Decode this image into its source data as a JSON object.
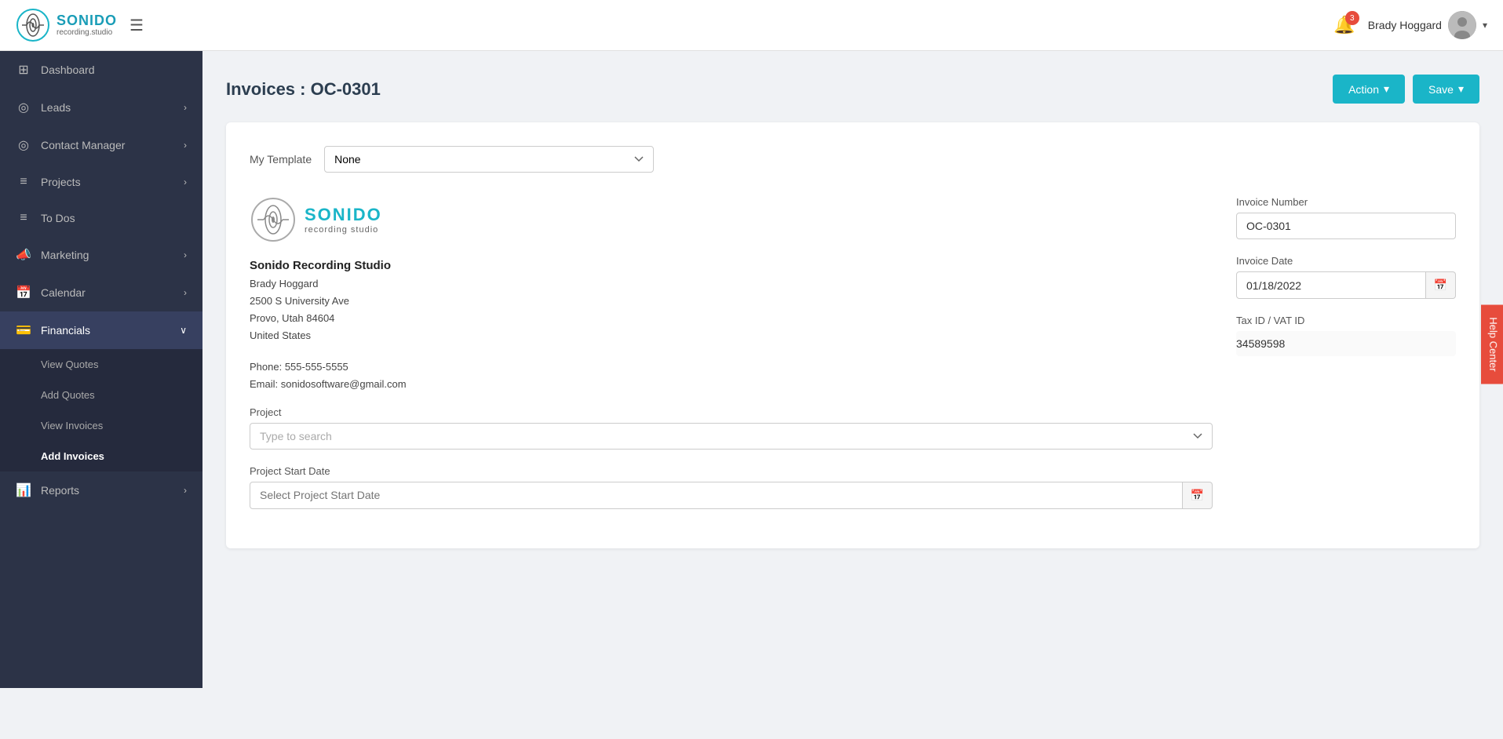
{
  "header": {
    "logo_title": "SONIDO",
    "logo_sub": "recording.studio",
    "notification_count": "3",
    "user_name": "Brady Hoggard",
    "chevron": "▾"
  },
  "sidebar": {
    "items": [
      {
        "id": "dashboard",
        "label": "Dashboard",
        "icon": "⊞",
        "has_sub": false,
        "active": false
      },
      {
        "id": "leads",
        "label": "Leads",
        "icon": "◎",
        "has_sub": true,
        "active": false
      },
      {
        "id": "contact-manager",
        "label": "Contact Manager",
        "icon": "◎",
        "has_sub": true,
        "active": false
      },
      {
        "id": "projects",
        "label": "Projects",
        "icon": "≡",
        "has_sub": true,
        "active": false
      },
      {
        "id": "todos",
        "label": "To Dos",
        "icon": "≡",
        "has_sub": false,
        "active": false
      },
      {
        "id": "marketing",
        "label": "Marketing",
        "icon": "📣",
        "has_sub": true,
        "active": false
      },
      {
        "id": "calendar",
        "label": "Calendar",
        "icon": "📅",
        "has_sub": true,
        "active": false
      },
      {
        "id": "financials",
        "label": "Financials",
        "icon": "💳",
        "has_sub": true,
        "active": true
      }
    ],
    "financials_sub": [
      {
        "id": "view-quotes",
        "label": "View Quotes",
        "active": false
      },
      {
        "id": "add-quotes",
        "label": "Add Quotes",
        "active": false
      },
      {
        "id": "view-invoices",
        "label": "View Invoices",
        "active": false
      },
      {
        "id": "add-invoices",
        "label": "Add Invoices",
        "active": true
      }
    ],
    "reports": {
      "label": "Reports",
      "icon": "📊",
      "has_sub": true
    }
  },
  "page": {
    "title": "Invoices : OC-0301",
    "action_btn": "Action",
    "save_btn": "Save",
    "chevron": "▾"
  },
  "template": {
    "label": "My Template",
    "value": "None",
    "options": [
      "None"
    ]
  },
  "company": {
    "name": "Sonido Recording Studio",
    "contact": "Brady Hoggard",
    "address1": "2500 S University Ave",
    "address2": "Provo, Utah 84604",
    "country": "United States",
    "phone": "Phone: 555-555-5555",
    "email": "Email: sonidosoftware@gmail.com"
  },
  "invoice": {
    "number_label": "Invoice Number",
    "number_value": "OC-0301",
    "date_label": "Invoice Date",
    "date_value": "01/18/2022",
    "tax_label": "Tax ID / VAT ID",
    "tax_value": "34589598"
  },
  "project_field": {
    "label": "Project",
    "placeholder": "Type to search"
  },
  "project_start": {
    "label": "Project Start Date",
    "placeholder": "Select Project Start Date"
  },
  "help_center": "Help Center"
}
